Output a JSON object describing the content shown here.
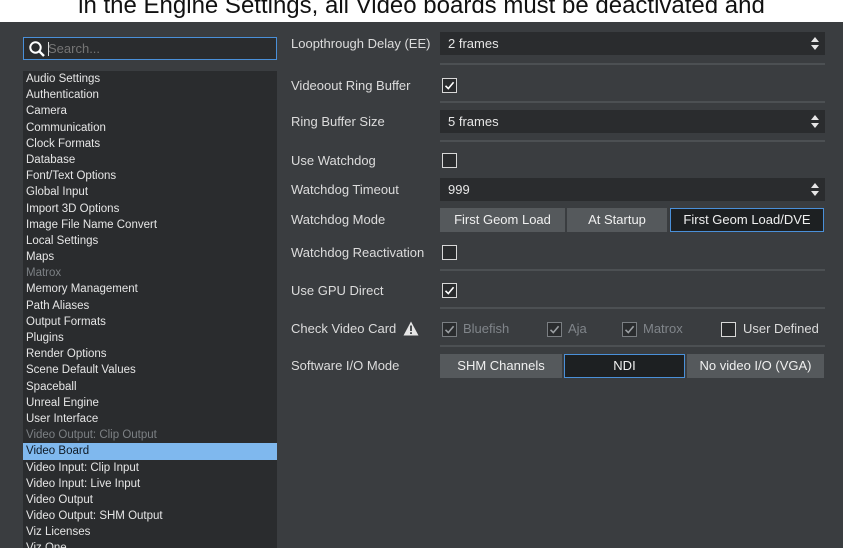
{
  "caption": "in the Engine Settings, all Video boards must be deactivated and",
  "search": {
    "placeholder": "Search..."
  },
  "sidebar": {
    "items": [
      {
        "label": "Audio Settings",
        "state": "normal"
      },
      {
        "label": "Authentication",
        "state": "normal"
      },
      {
        "label": "Camera",
        "state": "normal"
      },
      {
        "label": "Communication",
        "state": "normal"
      },
      {
        "label": "Clock Formats",
        "state": "normal"
      },
      {
        "label": "Database",
        "state": "normal"
      },
      {
        "label": "Font/Text Options",
        "state": "normal"
      },
      {
        "label": "Global Input",
        "state": "normal"
      },
      {
        "label": "Import 3D Options",
        "state": "normal"
      },
      {
        "label": "Image File Name Convert",
        "state": "normal"
      },
      {
        "label": "Local Settings",
        "state": "normal"
      },
      {
        "label": "Maps",
        "state": "normal"
      },
      {
        "label": "Matrox",
        "state": "disabled"
      },
      {
        "label": "Memory Management",
        "state": "normal"
      },
      {
        "label": "Path Aliases",
        "state": "normal"
      },
      {
        "label": "Output Formats",
        "state": "normal"
      },
      {
        "label": "Plugins",
        "state": "normal"
      },
      {
        "label": "Render Options",
        "state": "normal"
      },
      {
        "label": "Scene Default Values",
        "state": "normal"
      },
      {
        "label": "Spaceball",
        "state": "normal"
      },
      {
        "label": "Unreal Engine",
        "state": "normal"
      },
      {
        "label": "User Interface",
        "state": "normal"
      },
      {
        "label": "Video Output: Clip Output",
        "state": "disabled"
      },
      {
        "label": "Video Board",
        "state": "selected"
      },
      {
        "label": "Video Input: Clip Input",
        "state": "normal"
      },
      {
        "label": "Video Input: Live Input",
        "state": "normal"
      },
      {
        "label": "Video Output",
        "state": "normal"
      },
      {
        "label": "Video Output: SHM Output",
        "state": "normal"
      },
      {
        "label": "Viz Licenses",
        "state": "normal"
      },
      {
        "label": "Viz One",
        "state": "normal"
      }
    ]
  },
  "settings": {
    "loopthrough": {
      "label": "Loopthrough Delay (EE)",
      "value": "2 frames"
    },
    "videoout_ring": {
      "label": "Videoout Ring Buffer",
      "checked": true
    },
    "ring_size": {
      "label": "Ring Buffer Size",
      "value": "5 frames"
    },
    "use_watchdog": {
      "label": "Use Watchdog",
      "checked": false
    },
    "watchdog_timeout": {
      "label": "Watchdog Timeout",
      "value": "999"
    },
    "watchdog_mode": {
      "label": "Watchdog Mode",
      "options": [
        "First Geom Load",
        "At Startup",
        "First Geom Load/DVE"
      ],
      "selected": "First Geom Load/DVE"
    },
    "watchdog_reactivation": {
      "label": "Watchdog Reactivation",
      "checked": false
    },
    "use_gpu_direct": {
      "label": "Use GPU Direct",
      "checked": true
    },
    "check_video_card": {
      "label": "Check Video Card",
      "options": [
        {
          "label": "Bluefish",
          "checked": true,
          "enabled": false
        },
        {
          "label": "Aja",
          "checked": true,
          "enabled": false
        },
        {
          "label": "Matrox",
          "checked": true,
          "enabled": false
        },
        {
          "label": "User Defined",
          "checked": false,
          "enabled": true
        }
      ]
    },
    "software_io_mode": {
      "label": "Software I/O Mode",
      "options": [
        "SHM Channels",
        "NDI",
        "No video I/O (VGA)"
      ],
      "selected": "NDI"
    }
  },
  "colors": {
    "accent": "#4a90d9",
    "selected_item": "#7fb8ee",
    "panel": "#3a3d40",
    "field": "#2a2c2e"
  }
}
